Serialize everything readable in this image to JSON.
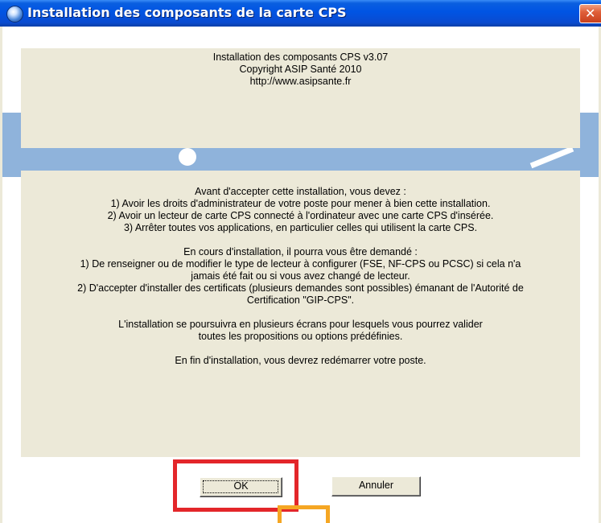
{
  "window": {
    "title": "Installation des composants de la carte CPS",
    "close_glyph": "✕",
    "title_icon": "globe-icon",
    "colors": {
      "titlebar": "#0054e3",
      "dialog_bg": "#ece9d8",
      "stripe": "#8fb3db",
      "highlight_red": "#e3262a",
      "highlight_orange": "#f5a623"
    }
  },
  "header_panel": {
    "lines": [
      "Installation des composants CPS v3.07",
      "Copyright ASIP Santé 2010",
      "http://www.asipsante.fr"
    ]
  },
  "main_panel": {
    "before_title": "Avant d'accepter cette installation, vous devez :",
    "before_items": [
      "1) Avoir les droits d'administrateur de votre poste pour mener à bien cette installation.",
      "2) Avoir un lecteur de carte CPS connecté à l'ordinateur avec une carte CPS d'insérée.",
      "3) Arrêter toutes vos applications, en particulier celles qui utilisent la carte CPS."
    ],
    "during_title": "En cours d'installation, il pourra vous être demandé :",
    "during_lines": [
      "1) De renseigner ou de modifier le type de lecteur à configurer (FSE, NF-CPS ou PCSC) si cela n'a",
      "jamais été fait ou si vous avez changé de lecteur.",
      "2) D'accepter d'installer des certificats (plusieurs demandes sont possibles) émanant de l'Autorité de",
      "Certification \"GIP-CPS\"."
    ],
    "continue_lines": [
      "L'installation se poursuivra en plusieurs écrans pour lesquels vous pourrez valider",
      "toutes les propositions ou options prédéfinies."
    ],
    "end_line": "En fin d'installation, vous devrez redémarrer votre poste."
  },
  "buttons": {
    "ok": "OK",
    "cancel": "Annuler"
  }
}
